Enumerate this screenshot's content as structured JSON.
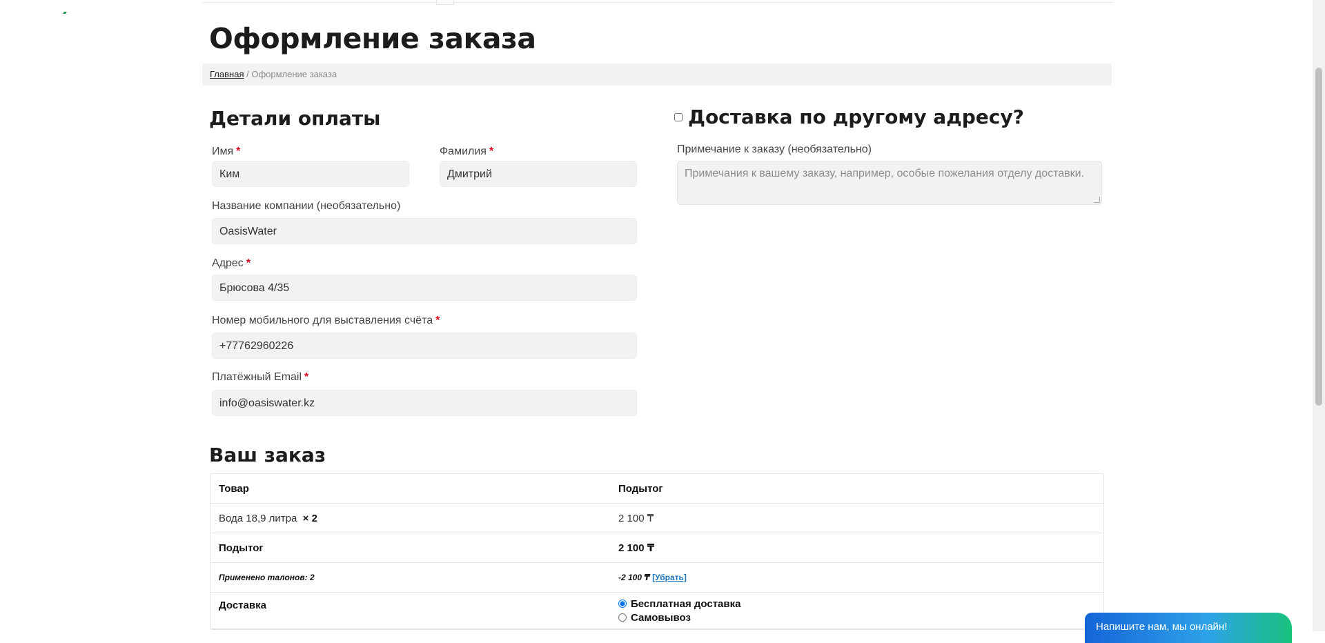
{
  "page": {
    "title": "Оформление заказа",
    "breadcrumb": {
      "home": "Главная",
      "separator": " / ",
      "current": "Оформление заказа"
    }
  },
  "billing": {
    "title": "Детали оплаты",
    "required_mark": "*",
    "first_name": {
      "label": "Имя",
      "value": "Ким"
    },
    "last_name": {
      "label": "Фамилия",
      "value": "Дмитрий"
    },
    "company": {
      "label": "Название компании (необязательно)",
      "value": "OasisWater"
    },
    "address": {
      "label": "Адрес",
      "value": "Брюсова 4/35"
    },
    "phone": {
      "label": "Номер мобильного для выставления счёта",
      "value": "+77762960226"
    },
    "email": {
      "label": "Платёжный Email",
      "value": "info@oasiswater.kz"
    }
  },
  "shipping": {
    "title": "Доставка по другому адресу?",
    "checked": false,
    "notes_label": "Примечание к заказу (необязательно)",
    "notes_placeholder": "Примечания к вашему заказу, например, особые пожелания отделу доставки."
  },
  "order": {
    "title": "Ваш заказ",
    "headers": {
      "product": "Товар",
      "subtotal": "Подытог"
    },
    "items": [
      {
        "name": "Вода 18,9 литра",
        "qty": "× 2",
        "subtotal": "2 100 ₸"
      }
    ],
    "subtotal_label": "Подытог",
    "subtotal_value": "2 100 ₸",
    "coupon_label": "Применено талонов: 2",
    "coupon_value": "-2 100 ₸",
    "coupon_remove": "[Убрать]",
    "delivery_label": "Доставка",
    "delivery_options": [
      {
        "label": "Бесплатная доставка",
        "selected": true
      },
      {
        "label": "Самовывоз",
        "selected": false
      }
    ]
  },
  "chat": {
    "label": "Напишите нам, мы онлайн!"
  },
  "colors": {
    "required": "#e0001b",
    "link": "#1e73be",
    "field_bg": "#f2f2f2"
  }
}
